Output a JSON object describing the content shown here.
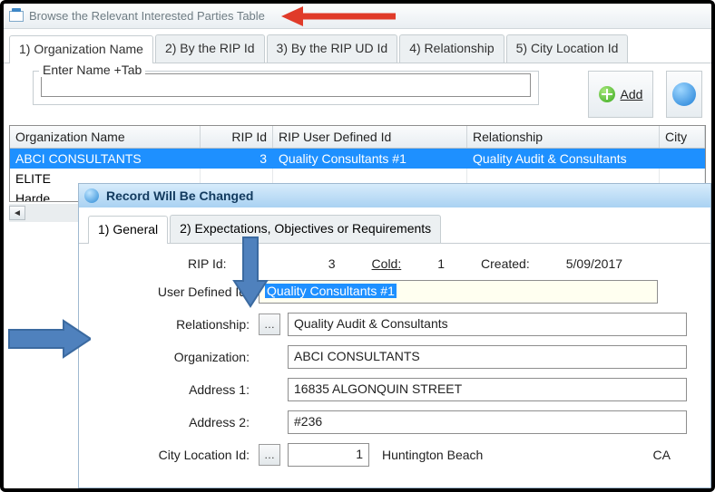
{
  "window": {
    "title": "Browse the Relevant Interested Parties Table"
  },
  "main_tabs": [
    "1) Organization Name",
    "2) By the RIP Id",
    "3) By the RIP UD Id",
    "4) Relationship",
    "5) City Location Id"
  ],
  "search": {
    "label": "Enter Name +Tab",
    "value": ""
  },
  "buttons": {
    "add": "Add"
  },
  "grid": {
    "headers": [
      "Organization Name",
      "RIP Id",
      "RIP User Defined Id",
      "Relationship",
      "City"
    ],
    "rows": [
      {
        "org": "ABCI CONSULTANTS",
        "rip": "3",
        "ud": "Quality Consultants #1",
        "rel": "Quality Audit & Consultants",
        "city": "",
        "selected": true
      },
      {
        "org": "ELITE",
        "rip": "",
        "ud": "",
        "rel": "",
        "city": "",
        "selected": false
      },
      {
        "org": "Harde",
        "rip": "",
        "ud": "",
        "rel": "",
        "city": "",
        "selected": false
      }
    ]
  },
  "sub": {
    "title": "Record Will Be Changed",
    "tabs": [
      "1) General",
      "2) Expectations, Objectives or Requirements"
    ],
    "stats": {
      "rip_label": "RIP Id:",
      "rip": "3",
      "cold_label": "Cold:",
      "cold": "1",
      "created_label": "Created:",
      "created": "5/09/2017"
    },
    "fields": {
      "udid_label": "User Defined Id:",
      "udid": "Quality Consultants #1",
      "rel_label": "Relationship:",
      "rel": "Quality Audit & Consultants",
      "org_label": "Organization:",
      "org": "ABCI CONSULTANTS",
      "addr1_label": "Address 1:",
      "addr1": "16835 ALGONQUIN STREET",
      "addr2_label": "Address 2:",
      "addr2": "#236",
      "cityid_label": "City Location Id:",
      "cityid": "1",
      "city": "Huntington Beach",
      "state": "CA"
    }
  }
}
